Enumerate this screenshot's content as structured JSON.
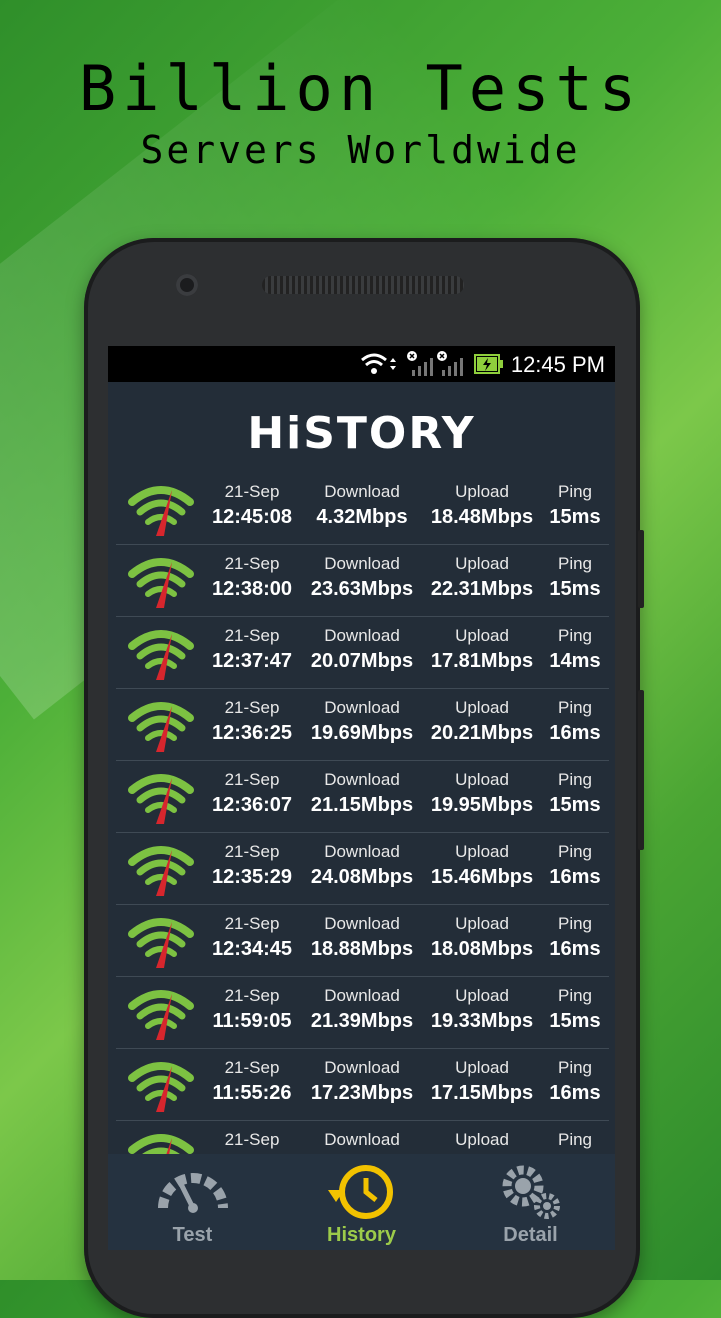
{
  "hero": {
    "title": "Billion Tests",
    "subtitle": "Servers Worldwide"
  },
  "statusbar": {
    "time": "12:45 PM",
    "icons": [
      "wifi-icon",
      "signal-icon",
      "signal-icon",
      "battery-charging-icon"
    ]
  },
  "screen": {
    "title": "HiSTORY"
  },
  "labels": {
    "download": "Download",
    "upload": "Upload",
    "ping": "Ping"
  },
  "history": [
    {
      "date": "21-Sep",
      "time": "12:45:08",
      "download": "4.32Mbps",
      "upload": "18.48Mbps",
      "ping": "15ms"
    },
    {
      "date": "21-Sep",
      "time": "12:38:00",
      "download": "23.63Mbps",
      "upload": "22.31Mbps",
      "ping": "15ms"
    },
    {
      "date": "21-Sep",
      "time": "12:37:47",
      "download": "20.07Mbps",
      "upload": "17.81Mbps",
      "ping": "14ms"
    },
    {
      "date": "21-Sep",
      "time": "12:36:25",
      "download": "19.69Mbps",
      "upload": "20.21Mbps",
      "ping": "16ms"
    },
    {
      "date": "21-Sep",
      "time": "12:36:07",
      "download": "21.15Mbps",
      "upload": "19.95Mbps",
      "ping": "15ms"
    },
    {
      "date": "21-Sep",
      "time": "12:35:29",
      "download": "24.08Mbps",
      "upload": "15.46Mbps",
      "ping": "16ms"
    },
    {
      "date": "21-Sep",
      "time": "12:34:45",
      "download": "18.88Mbps",
      "upload": "18.08Mbps",
      "ping": "16ms"
    },
    {
      "date": "21-Sep",
      "time": "11:59:05",
      "download": "21.39Mbps",
      "upload": "19.33Mbps",
      "ping": "15ms"
    },
    {
      "date": "21-Sep",
      "time": "11:55:26",
      "download": "17.23Mbps",
      "upload": "17.15Mbps",
      "ping": "16ms"
    },
    {
      "date": "21-Sep",
      "time": "",
      "download": "",
      "upload": "",
      "ping": ""
    }
  ],
  "nav": {
    "items": [
      {
        "label": "Test",
        "icon": "speedometer-icon"
      },
      {
        "label": "History",
        "icon": "history-clock-icon"
      },
      {
        "label": "Detail",
        "icon": "gears-icon"
      }
    ],
    "active": "History"
  },
  "colors": {
    "accent": "#9ccb4a",
    "gauge_green": "#7dc242",
    "gauge_needle": "#d7262d",
    "screen_bg": "#232d38",
    "nav_bg": "#253240"
  }
}
